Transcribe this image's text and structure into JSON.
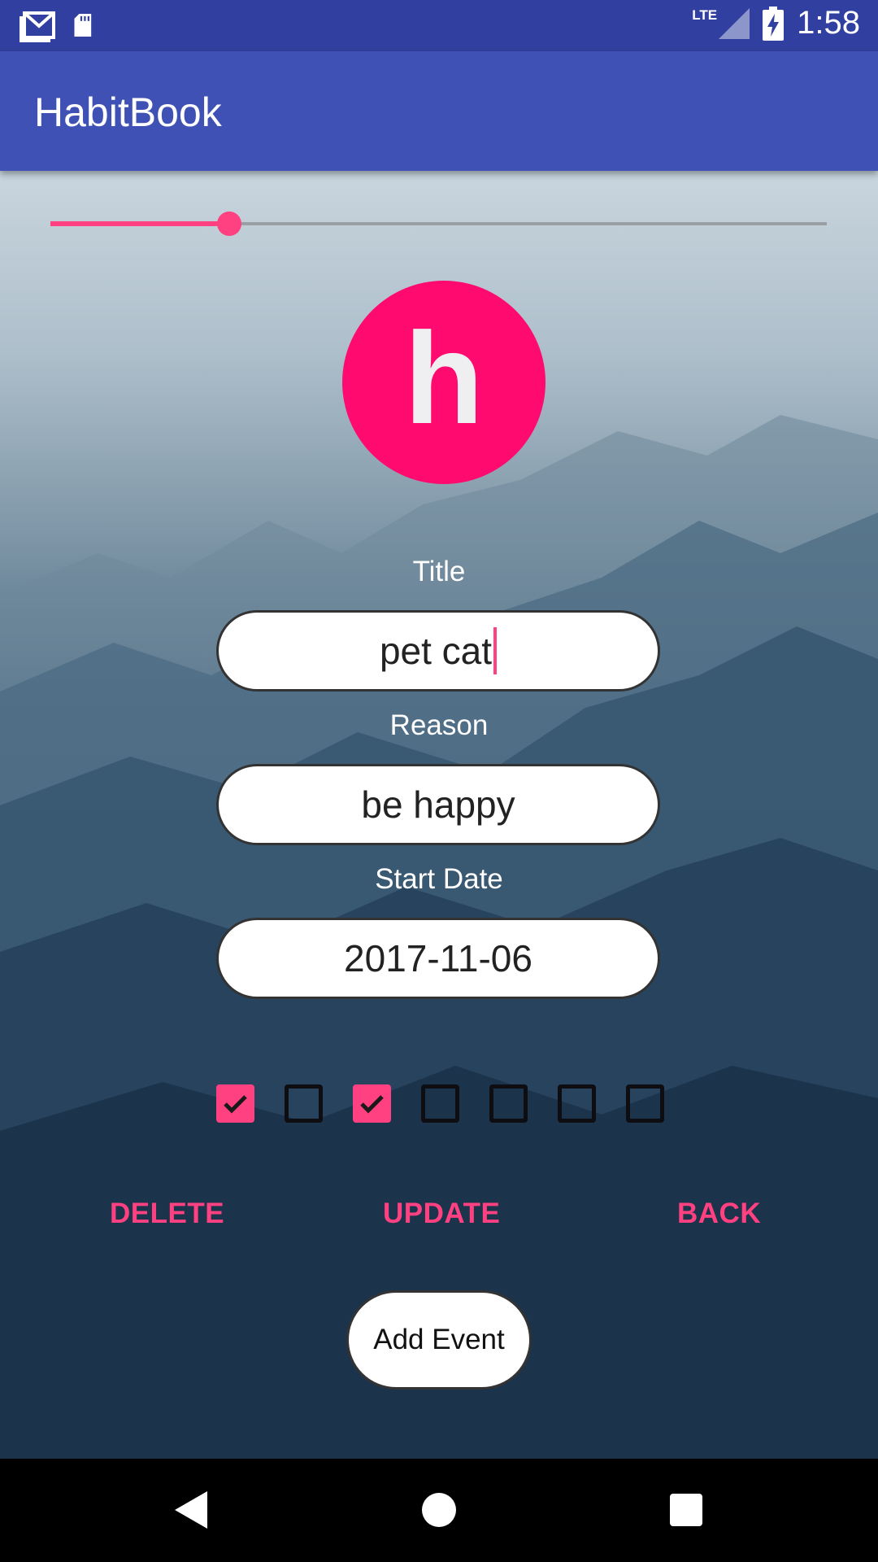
{
  "status_bar": {
    "time": "1:58",
    "network": "LTE",
    "icons": [
      "gmail-icon",
      "sd-card-icon",
      "signal-icon",
      "battery-charging-icon"
    ]
  },
  "app_bar": {
    "title": "HabitBook"
  },
  "slider": {
    "value_fraction": 0.23
  },
  "avatar": {
    "letter": "h",
    "color": "#ff0a6e"
  },
  "form": {
    "title_label": "Title",
    "title_value": "pet cat",
    "reason_label": "Reason",
    "reason_value": "be happy",
    "start_date_label": "Start Date",
    "start_date_value": "2017-11-06"
  },
  "days": [
    {
      "checked": true
    },
    {
      "checked": false
    },
    {
      "checked": true
    },
    {
      "checked": false
    },
    {
      "checked": false
    },
    {
      "checked": false
    },
    {
      "checked": false
    }
  ],
  "actions": {
    "delete_label": "DELETE",
    "update_label": "UPDATE",
    "back_label": "BACK"
  },
  "add_event_label": "Add Event",
  "colors": {
    "primary": "#3f51b5",
    "primary_dark": "#3140a0",
    "accent": "#ff4081"
  }
}
